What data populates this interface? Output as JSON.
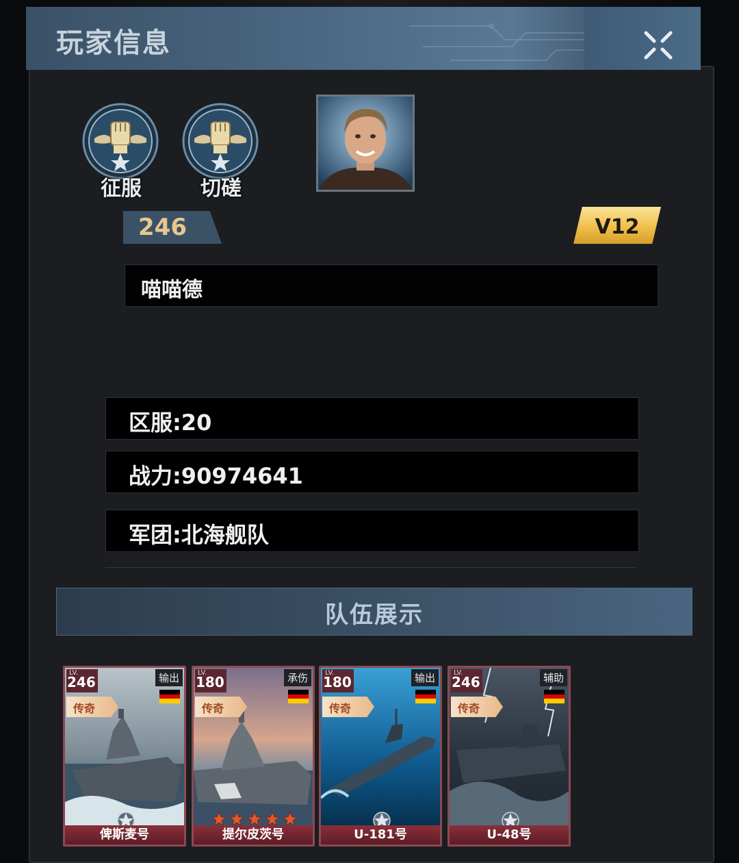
{
  "header": {
    "title": "玩家信息"
  },
  "badges": [
    {
      "label": "征服",
      "icon": "fist-emblem-icon"
    },
    {
      "label": "切磋",
      "icon": "fist-emblem-icon"
    }
  ],
  "player": {
    "level": "246",
    "vip": "V12",
    "name": "喵喵德"
  },
  "info": {
    "server": "区服:20",
    "power": "战力:90974641",
    "legion": "军团:北海舰队"
  },
  "team": {
    "title": "队伍展示",
    "lv_prefix": "LV.",
    "ships": [
      {
        "level": "246",
        "role": "输出",
        "rarity": "传奇",
        "name": "俾斯麦号",
        "stars": 0
      },
      {
        "level": "180",
        "role": "承伤",
        "rarity": "传奇",
        "name": "提尔皮茨号",
        "stars": 5
      },
      {
        "level": "180",
        "role": "输出",
        "rarity": "传奇",
        "name": "U-181号",
        "stars": 0
      },
      {
        "level": "246",
        "role": "辅助",
        "rarity": "传奇",
        "name": "U-48号",
        "stars": 0
      }
    ]
  },
  "colors": {
    "header": "#4a6680",
    "vip_gold": "#f0bf4a",
    "card_border": "#8b4a52",
    "card_name_bg": "#8a2f3a"
  }
}
